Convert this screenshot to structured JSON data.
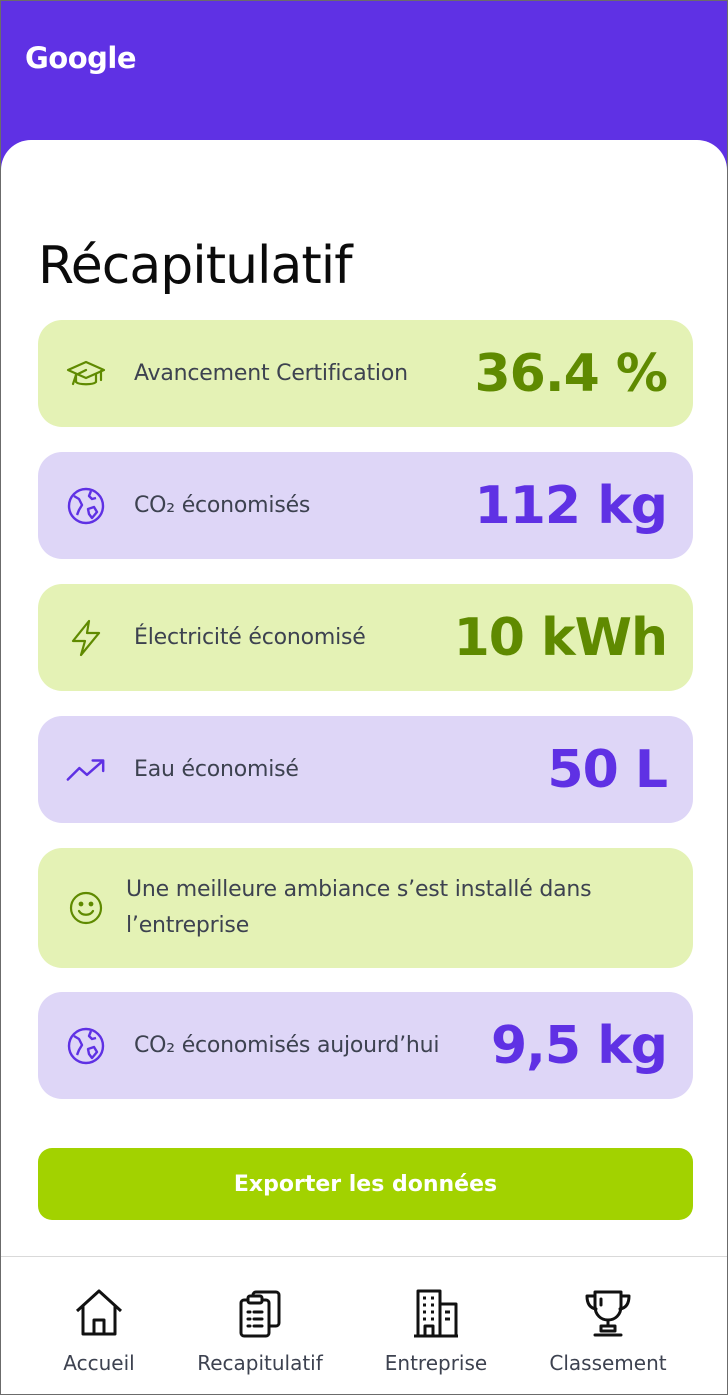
{
  "app": {
    "brand": "Google"
  },
  "page": {
    "title": "Récapitulatif"
  },
  "cards": [
    {
      "label": "Avancement Certification",
      "value": "36.4 %",
      "icon": "graduation-cap-icon",
      "tone": "green"
    },
    {
      "label": "CO₂ économisés",
      "value": "112 kg",
      "icon": "globe-icon",
      "tone": "purple"
    },
    {
      "label": "Électricité économisé",
      "value": "10 kWh",
      "icon": "lightning-icon",
      "tone": "green"
    },
    {
      "label": "Eau économisé",
      "value": "50 L",
      "icon": "trending-up-icon",
      "tone": "purple"
    },
    {
      "label": "Une meilleure ambiance s’est installé dans l’entreprise",
      "value": "",
      "icon": "smiley-icon",
      "tone": "green"
    },
    {
      "label": "CO₂ économisés aujourd’hui",
      "value": "9,5 kg",
      "icon": "globe-icon",
      "tone": "purple"
    }
  ],
  "actions": {
    "export_label": "Exporter les données"
  },
  "nav": [
    {
      "label": "Accueil",
      "icon": "home-icon"
    },
    {
      "label": "Recapitulatif",
      "icon": "clipboard-icon"
    },
    {
      "label": "Entreprise",
      "icon": "building-icon"
    },
    {
      "label": "Classement",
      "icon": "trophy-icon"
    }
  ],
  "colors": {
    "header": "#5f31e4",
    "card_green": "#e4f2b5",
    "card_purple": "#ded6f7",
    "value_green": "#5f8a00",
    "value_purple": "#5f31e4",
    "button": "#a2d200"
  }
}
